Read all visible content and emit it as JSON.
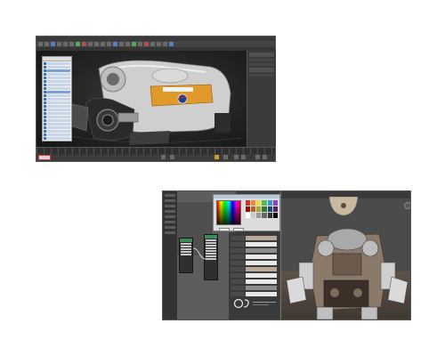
{
  "screenshot1": {
    "app": "3ds Max style 3D modeling application",
    "menu_items": [
      "",
      "",
      "",
      "",
      "",
      "",
      "",
      "",
      "",
      "",
      ""
    ],
    "viewport_subject": "robot mech model with NASA insignia",
    "explorer_rows": 24,
    "colors": {
      "viewport_bg": "#222222",
      "explorer_bg": "#f1f1f1",
      "selection_blue": "#3b6fc6"
    }
  },
  "screenshot2": {
    "app": "3D material / node editor with color picker and render view",
    "color_picker": {
      "ok_label": "",
      "cancel_label": ""
    },
    "render_subject": "robot mech model rendered",
    "colors": {
      "node_header": "#3f8a5a",
      "editor_bg": "#3d3d3d"
    }
  }
}
